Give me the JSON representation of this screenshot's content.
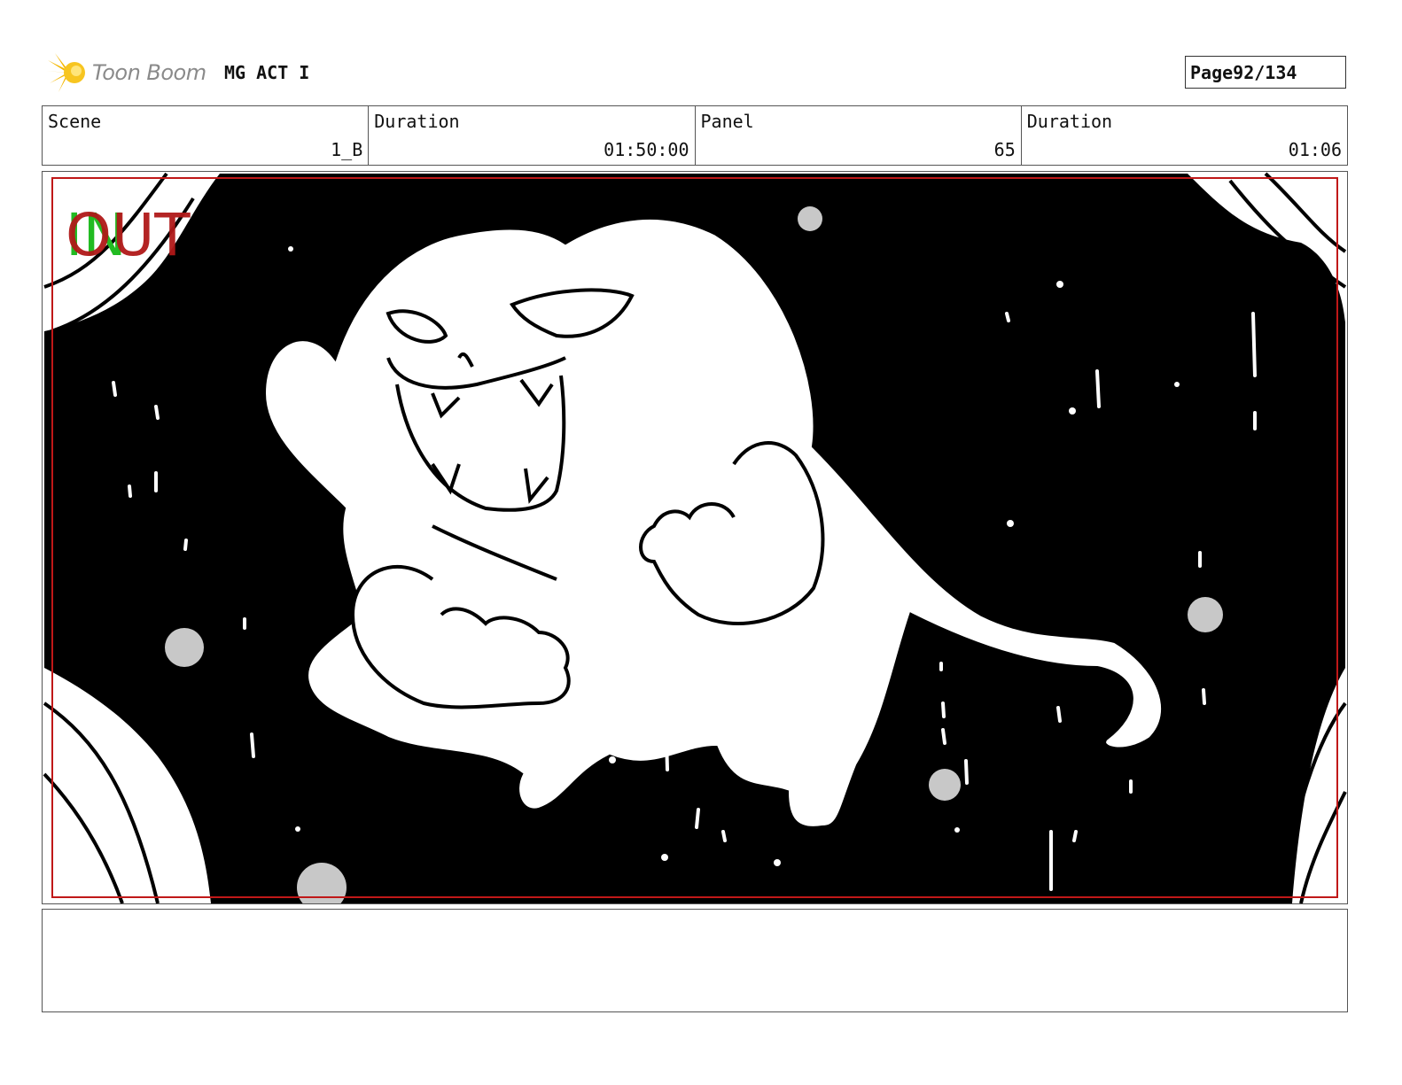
{
  "header": {
    "logo_text": "Toon Boom",
    "project_title": "MG ACT I",
    "page_label": "Page",
    "page_number": "92/134"
  },
  "info": {
    "scene_label": "Scene",
    "scene_value": "1_B",
    "scene_duration_label": "Duration",
    "scene_duration_value": "01:50:00",
    "panel_label": "Panel",
    "panel_value": "65",
    "panel_duration_label": "Duration",
    "panel_duration_value": "01:06"
  },
  "panel": {
    "in_marker": "IN",
    "out_marker": "OUT",
    "in_color": "#22bb22",
    "out_color": "#b01818",
    "safe_frame_color": "#c01818"
  },
  "notes": {
    "text": ""
  }
}
